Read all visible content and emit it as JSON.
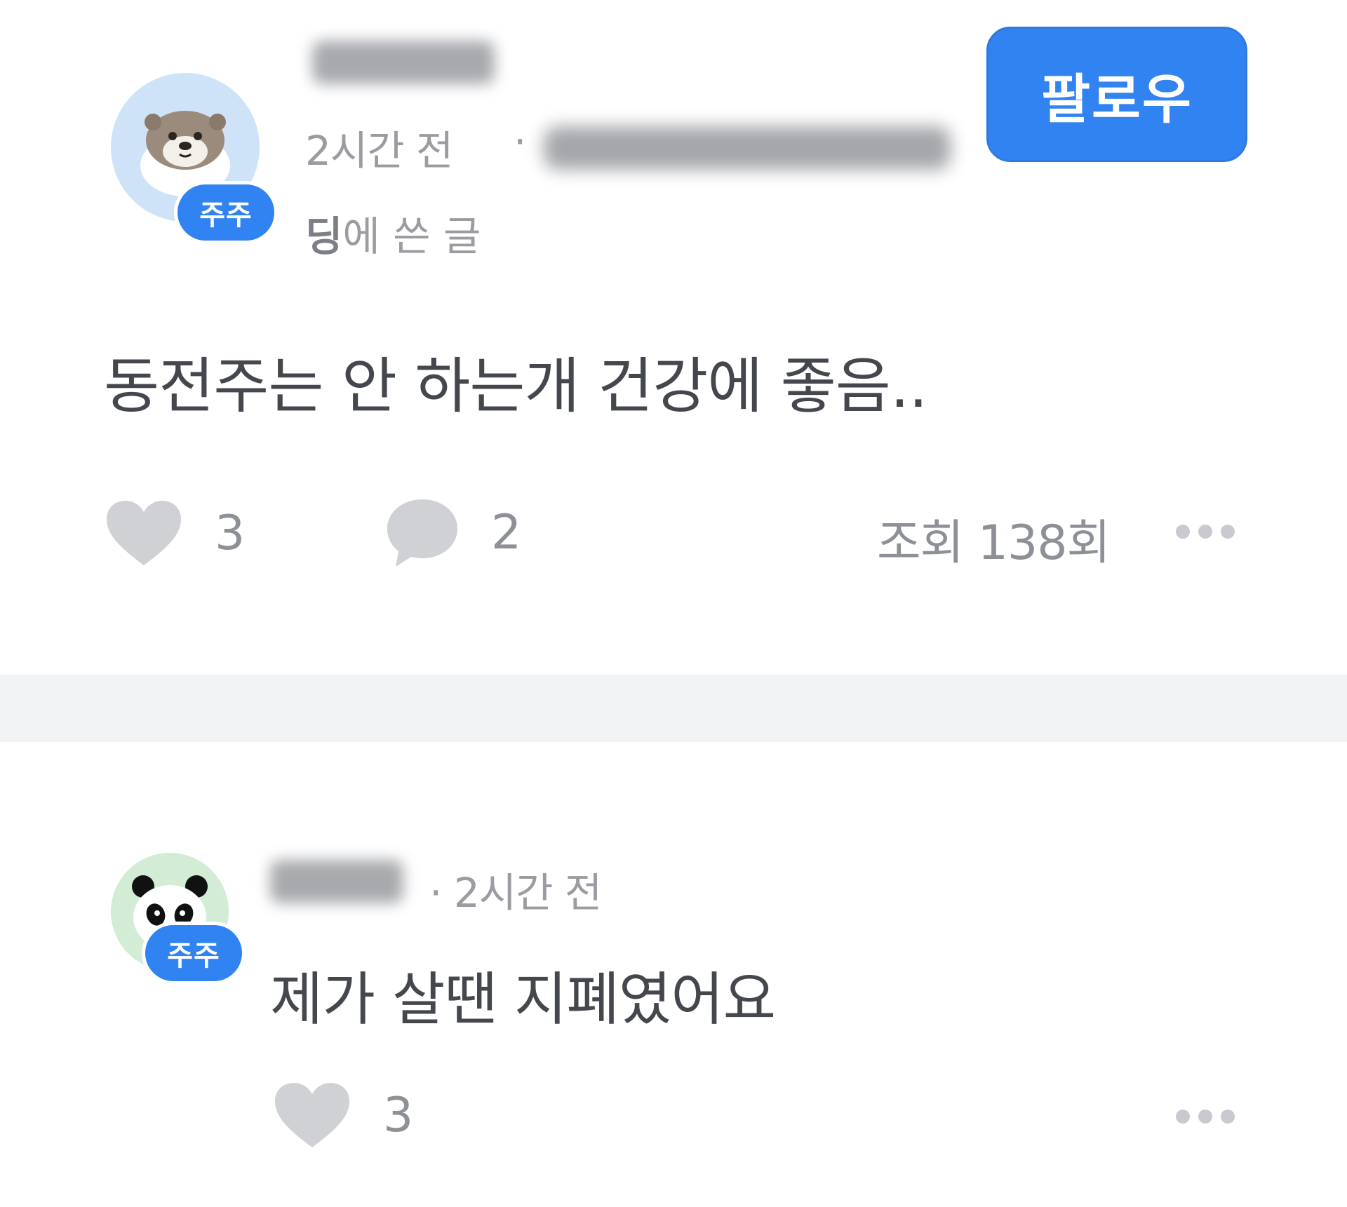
{
  "post": {
    "author_badge": "주주",
    "time": "2시간 전",
    "meta_separator": "·",
    "board_suffix_bold": "딩",
    "board_suffix": "에 쓴 글",
    "follow_label": "팔로우",
    "body": "동전주는 안 하는개 건강에 좋음..",
    "like_count": "3",
    "comment_count": "2",
    "views": "조회 138회",
    "avatar_icon": "otter-avatar-icon"
  },
  "comment": {
    "author_badge": "주주",
    "meta": "· 2시간 전",
    "body": "제가 살땐 지폐였어요",
    "like_count": "3",
    "avatar_icon": "panda-avatar-icon"
  },
  "colors": {
    "accent": "#3183f1",
    "divider": "#f2f3f5",
    "icon_gray": "#cfd1d5",
    "meta_text": "#9a9ca1"
  }
}
